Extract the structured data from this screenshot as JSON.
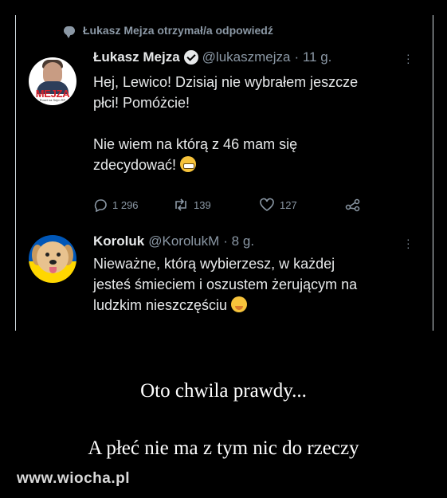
{
  "context_line": "Łukasz Mejza otrzymał/a odpowiedź",
  "tweet1": {
    "name": "Łukasz Mejza",
    "handle": "@lukaszmejza",
    "time": "· 11 g.",
    "avatar_logo": "MEJZA",
    "avatar_sub": "Poseł na Sejm RP",
    "line1": "Hej, Lewico! Dzisiaj nie wybrałem jeszcze",
    "line2": "płci! Pomóżcie!",
    "line3": "Nie wiem na którą z 46 mam się",
    "line4": "zdecydować!",
    "replies": "1 296",
    "retweets": "139",
    "likes": "127",
    "emoji": "grimacing-face"
  },
  "tweet2": {
    "name": "Koroluk",
    "handle": "@KorolukM",
    "time": "· 8 g.",
    "line1": "Nieważne, którą wybierzesz, w każdej",
    "line2": "jesteś śmieciem i oszustem żerującym na",
    "line3": "ludzkim nieszczęściu",
    "emoji": "hugging-face"
  },
  "caption1": "Oto chwila prawdy...",
  "caption2": "A płeć nie ma z tym nic do rzeczy",
  "watermark": "www.wiocha.pl",
  "colors": {
    "background": "#000000",
    "muted": "#8b98a5",
    "text": "#e7e9ea"
  }
}
